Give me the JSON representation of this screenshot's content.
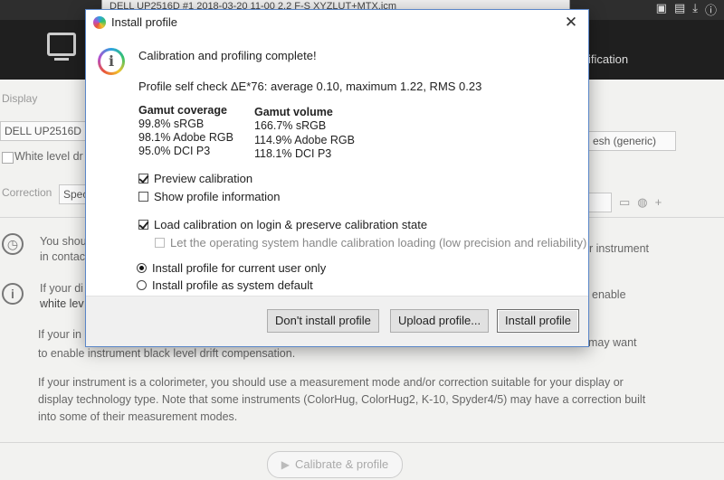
{
  "background": {
    "profile_select_value": "DELL UP2516D #1 2018-03-20 11-00 2.2 F-S XYZLUT+MTX.icm",
    "header_tab_fragment": "ification",
    "display_label": "Display",
    "display_value": "DELL UP2516D @",
    "refresh_value": "esh (generic)",
    "white_level_label": "White level dr",
    "correction_label": "Correction",
    "correction_value": "Spec",
    "text_1a": "You shou",
    "text_1b": "in contac",
    "text_1c": "r instrument",
    "text_2a": "If your di",
    "text_2b": "white lev",
    "text_2c": "enable",
    "text_3a": "If your in",
    "text_3b": "to enable instrument black level drift compensation.",
    "text_3c": "may want",
    "text_4a": "If your instrument is a colorimeter, you should use a measurement mode and/or correction suitable for your display or",
    "text_4b": "display technology type. Note that some instruments (ColorHug, ColorHug2, K-10, Spyder4/5) may have a correction built",
    "text_4c": "into some of their measurement modes.",
    "calibrate_label": "Calibrate & profile"
  },
  "dialog": {
    "title": "Install profile",
    "heading": "Calibration and profiling complete!",
    "self_check": "Profile self check ΔE*76: average 0.10, maximum 1.22, RMS 0.23",
    "gamut_coverage_label": "Gamut coverage",
    "gamut_coverage": [
      "99.8% sRGB",
      "98.1% Adobe RGB",
      "95.0% DCI P3"
    ],
    "gamut_volume_label": "Gamut volume",
    "gamut_volume": [
      "166.7% sRGB",
      "114.9% Adobe RGB",
      "118.1% DCI P3"
    ],
    "preview_calibration": "Preview calibration",
    "show_profile_info": "Show profile information",
    "load_calibration": "Load calibration on login & preserve calibration state",
    "os_handle_loading": "Let the operating system handle calibration loading (low precision and reliability)",
    "install_current_user": "Install profile for current user only",
    "install_system_default": "Install profile as system default",
    "btn_dont_install": "Don't install profile",
    "btn_upload": "Upload profile...",
    "btn_install": "Install profile"
  }
}
